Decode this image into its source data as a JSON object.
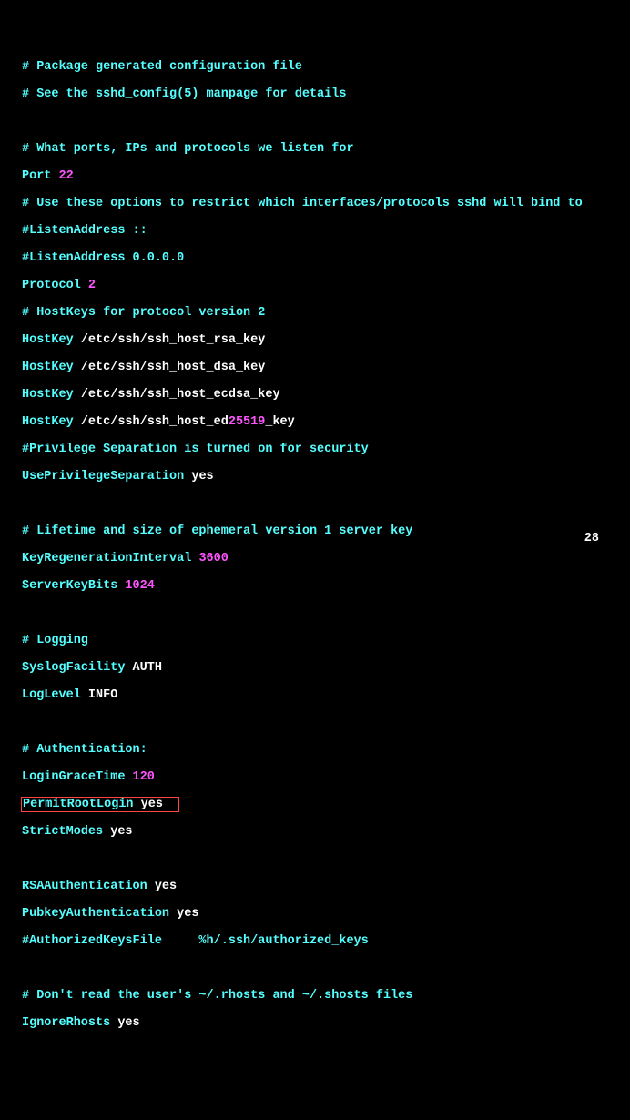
{
  "lines": {
    "l01": "# Package generated configuration file",
    "l02": "# See the sshd_config(5) manpage for details",
    "l04": "# What ports, IPs and protocols we listen for",
    "l05k": "Port ",
    "l05v": "22",
    "l06": "# Use these options to restrict which interfaces/protocols sshd will bind to",
    "l07": "#ListenAddress ::",
    "l08": "#ListenAddress 0.0.0.0",
    "l09k": "Protocol ",
    "l09v": "2",
    "l10": "# HostKeys for protocol version 2",
    "l11k": "HostKey ",
    "l11v": "/etc/ssh/ssh_host_rsa_key",
    "l12k": "HostKey ",
    "l12v": "/etc/ssh/ssh_host_dsa_key",
    "l13k": "HostKey ",
    "l13v": "/etc/ssh/ssh_host_ecdsa_key",
    "l14k": "HostKey ",
    "l14v1": "/etc/ssh/ssh_host_ed",
    "l14v2": "25519",
    "l14v3": "_key",
    "l15": "#Privilege Separation is turned on for security",
    "l16k": "UsePrivilegeSeparation ",
    "l16v": "yes",
    "l18": "# Lifetime and size of ephemeral version 1 server key",
    "l19k": "KeyRegenerationInterval ",
    "l19v": "3600",
    "l20k": "ServerKeyBits ",
    "l20v": "1024",
    "l22": "# Logging",
    "l23k": "SyslogFacility ",
    "l23v": "AUTH",
    "l24k": "LogLevel ",
    "l24v": "INFO",
    "l26": "# Authentication:",
    "l27k": "LoginGraceTime ",
    "l27v": "120",
    "l28k": "PermitRootLogin ",
    "l28v": "yes",
    "l29k": "StrictModes ",
    "l29v": "yes",
    "l31k": "RSAAuthentication ",
    "l31v": "yes",
    "l32k": "PubkeyAuthentication ",
    "l32v": "yes",
    "l33": "#AuthorizedKeysFile     %h/.ssh/authorized_keys",
    "l35": "# Don't read the user's ~/.rhosts and ~/.shosts files",
    "l36k": "IgnoreRhosts ",
    "l36v": "yes"
  },
  "highlight_padding": "  ",
  "linenum": "28"
}
